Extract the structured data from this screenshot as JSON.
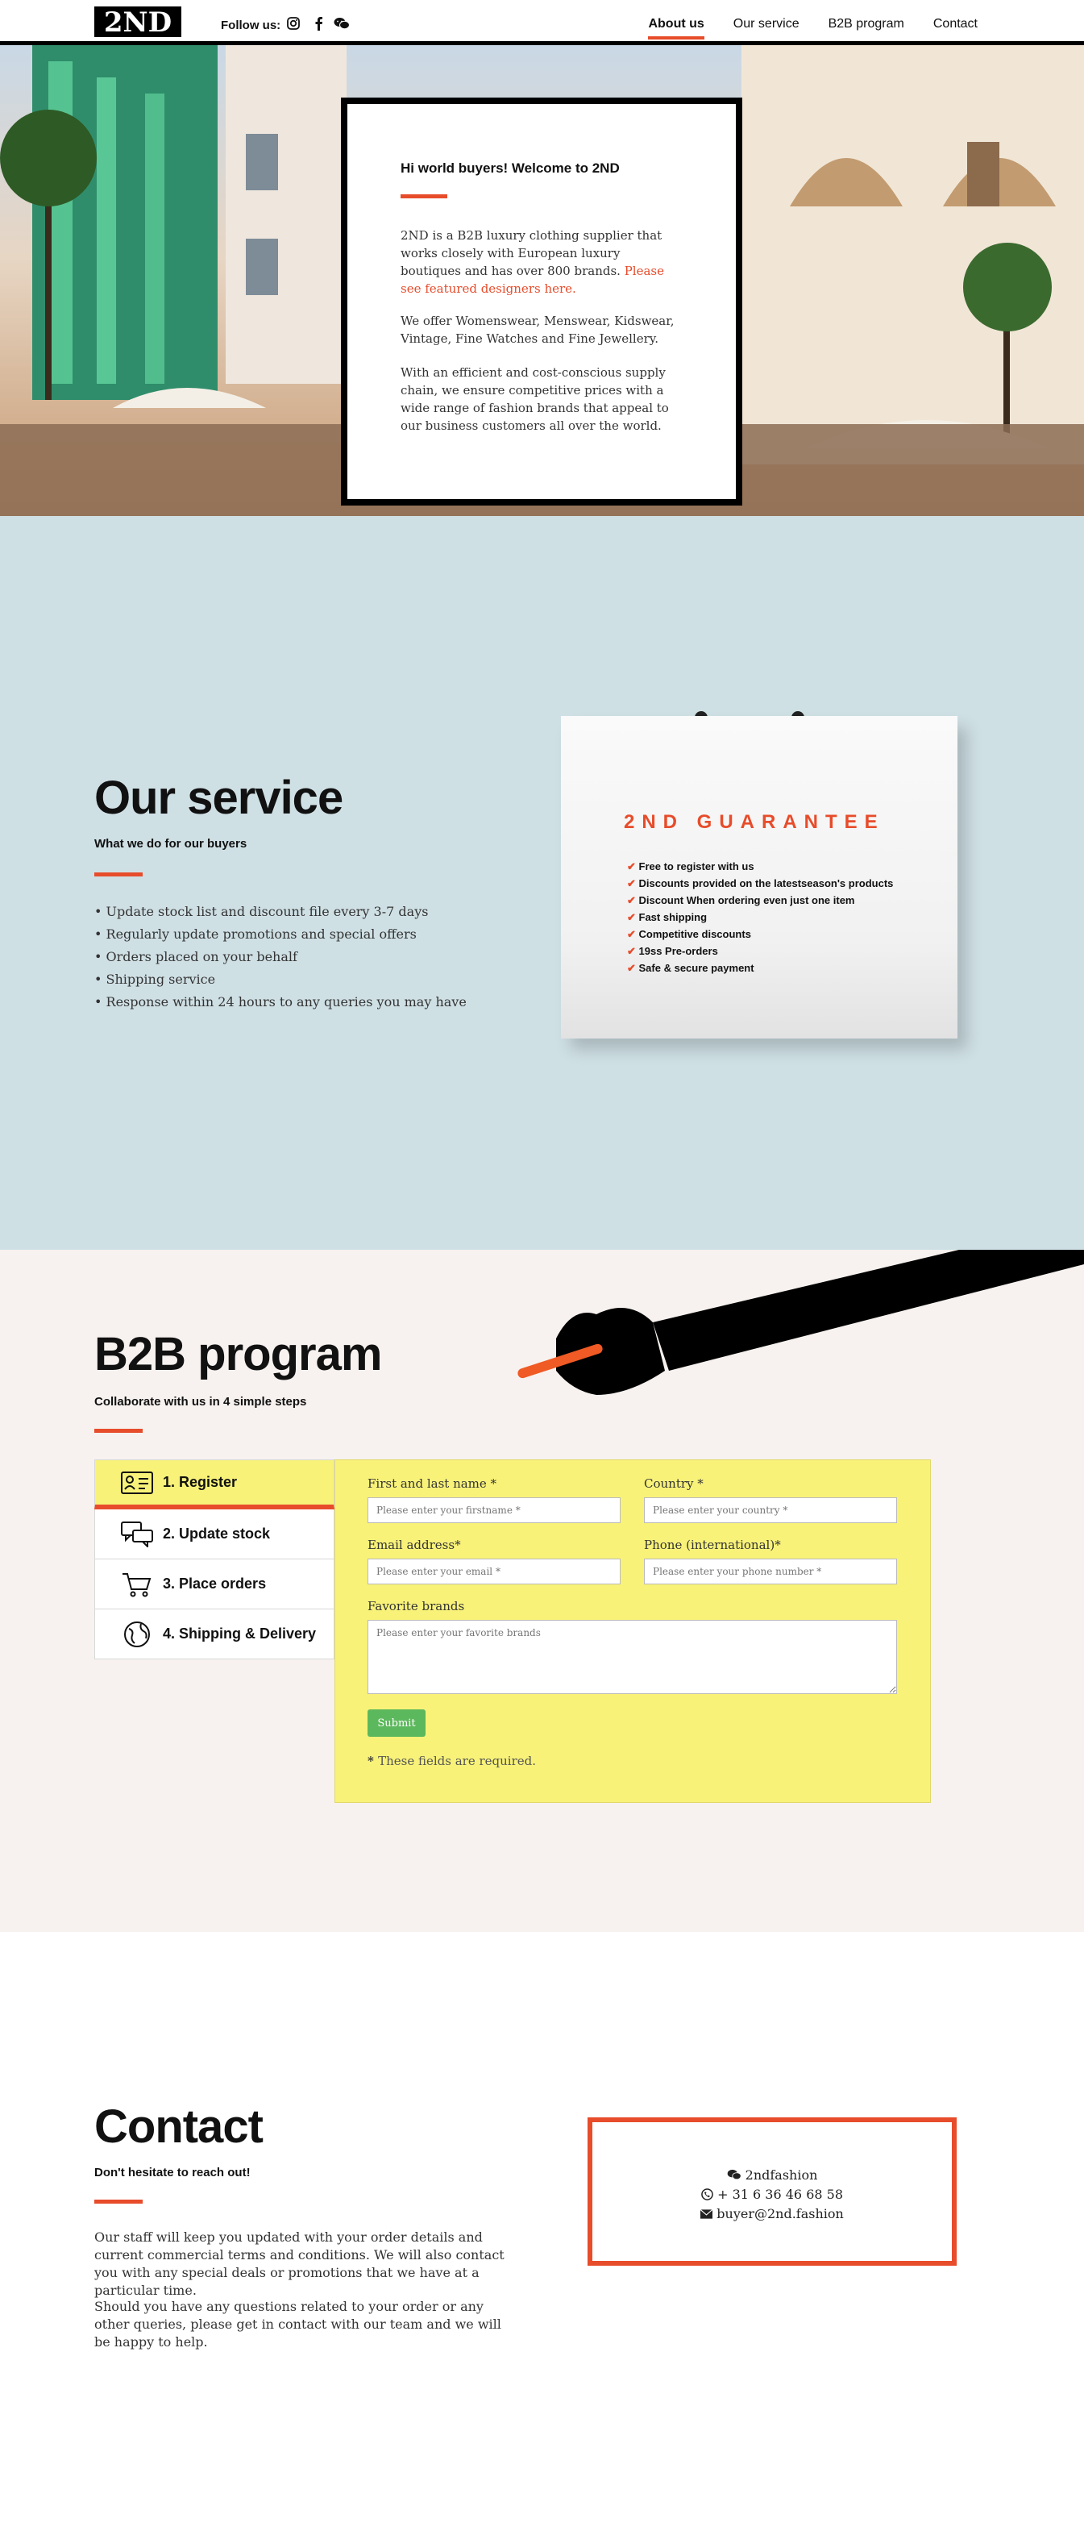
{
  "nav": {
    "logo_text": "2ND",
    "follow_label": "Follow us:",
    "social_icons": [
      "instagram-icon",
      "facebook-icon",
      "wechat-icon"
    ],
    "menu": [
      "About us",
      "Our service",
      "B2B program",
      "Contact"
    ],
    "active_menu": "About us"
  },
  "hero": {
    "title": "Hi world buyers! Welcome to 2ND",
    "paragraph1": "2ND is a B2B luxury clothing supplier that works closely with European luxury boutiques and has over 800 brands.",
    "paragraph1_link": "Please see featured designers here.",
    "paragraph2": "We offer Womenswear, Menswear, Kidswear, Vintage, Fine Watches and Fine Jewellery.",
    "paragraph3": "With an efficient and cost-conscious supply chain, we ensure competitive prices with a wide range of fashion brands that appeal to our business customers all over the world."
  },
  "service": {
    "title": "Our service",
    "subtitle": "What we do for our buyers",
    "items": [
      "Update stock list and discount file every 3-7 days",
      "Regularly update promotions and special offers",
      "Orders placed on your behalf",
      "Shipping service",
      "Response within 24 hours to any queries you may have"
    ],
    "bag": {
      "title": "2ND GUARANTEE",
      "items": [
        "Free to register with us",
        "Discounts provided on the latestseason's products",
        "Discount When ordering even just one item",
        "Fast shipping",
        "Competitive discounts",
        "19ss Pre-orders",
        "Safe & secure payment"
      ]
    }
  },
  "b2b": {
    "title": "B2B program",
    "subtitle": "Collaborate with us in 4 simple steps",
    "tabs": [
      "1. Register",
      "2. Update stock",
      "3. Place orders",
      "4. Shipping & Delivery"
    ],
    "form": {
      "first_name_label": "First and last name *",
      "first_name_placeholder": "Please enter your firstname *",
      "country_label": "Country *",
      "country_placeholder": "Please enter your country *",
      "email_label": "Email address*",
      "email_placeholder": "Please enter your email *",
      "phone_label": "Phone (international)*",
      "phone_placeholder": "Please enter your phone number *",
      "brands_label": "Favorite brands",
      "brands_placeholder": "Please enter your favorite brands",
      "submit_label": "Submit",
      "required_note": "These fields are required."
    }
  },
  "contact": {
    "title": "Contact",
    "subtitle": "Don't hesitate to reach out!",
    "paragraph1": "Our staff will keep you updated with your order details and current commercial terms and conditions. We will also contact you with any special deals or promotions that we have at a particular time.",
    "paragraph2": "Should you have any questions related to your order or any other queries, please get in contact with our team and we will be happy to help.",
    "wechat": "2ndfashion",
    "phone": "+ 31 6 36 46 68 58",
    "email": "buyer@2nd.fashion"
  },
  "colors": {
    "accent": "#e74c2b",
    "service_bg": "#cfe0e5",
    "form_bg": "#f8f279",
    "submit": "#5cb85c"
  }
}
